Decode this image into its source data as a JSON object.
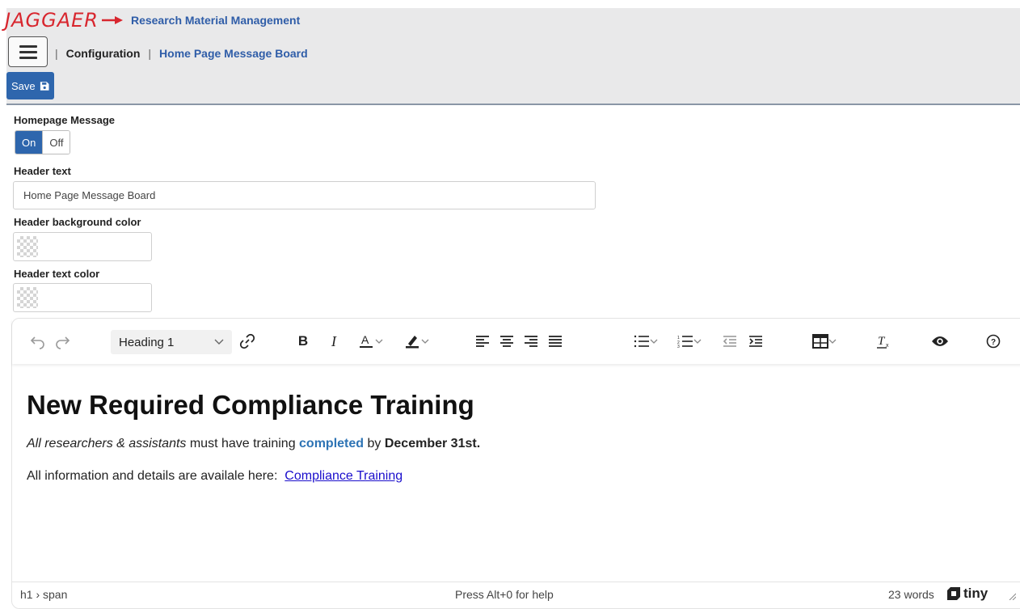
{
  "header": {
    "logo_text": "JAGGAER",
    "app_title": "Research Material Management",
    "breadcrumb": {
      "separator": "|",
      "section": "Configuration",
      "current": "Home Page Message Board"
    },
    "save_label": "Save"
  },
  "form": {
    "homepage_message": {
      "label": "Homepage Message",
      "on": "On",
      "off": "Off",
      "selected": "On"
    },
    "header_text": {
      "label": "Header text",
      "value": "Home Page Message Board"
    },
    "header_bg_color": {
      "label": "Header background color",
      "value": ""
    },
    "header_text_color": {
      "label": "Header text color",
      "value": ""
    }
  },
  "editor": {
    "block_format": "Heading 1",
    "content": {
      "heading": "New Required Compliance Training",
      "p1_italic": "All researchers & assistants",
      "p1_mid": " must have training ",
      "p1_highlight": "completed",
      "p1_by": " by ",
      "p1_bold": "December 31st.",
      "p2_text": "All information and details are availale here:  ",
      "p2_link": "Compliance Training"
    },
    "status": {
      "path": "h1 › span",
      "help": "Press Alt+0 for help",
      "words": "23 words",
      "brand": "tiny"
    }
  },
  "colors": {
    "brand_red": "#d8262e",
    "accent_blue": "#2e66ad",
    "link_blue": "#1a0dcc",
    "highlight_blue": "#2e74b5"
  }
}
